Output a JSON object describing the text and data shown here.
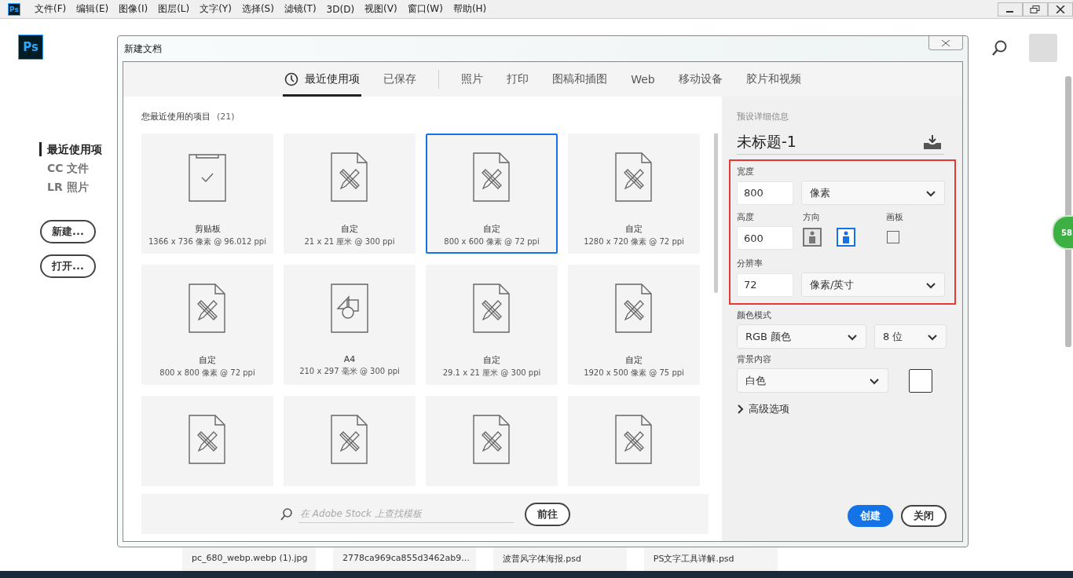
{
  "menu_bar": {
    "app_icon": "Ps",
    "items": [
      "文件(F)",
      "编辑(E)",
      "图像(I)",
      "图层(L)",
      "文字(Y)",
      "选择(S)",
      "滤镜(T)",
      "3D(D)",
      "视图(V)",
      "窗口(W)",
      "帮助(H)"
    ]
  },
  "home": {
    "logo": "Ps",
    "nav": [
      {
        "label": "最近使用项",
        "selected": true
      },
      {
        "label": "CC 文件",
        "selected": false
      },
      {
        "label": "LR 照片",
        "selected": false
      }
    ],
    "buttons": [
      "新建...",
      "打开..."
    ],
    "badge": "58"
  },
  "dialog": {
    "title": "新建文档",
    "tabs": [
      {
        "label": "最近使用项",
        "selected": true,
        "icon": true
      },
      {
        "label": "已保存",
        "selected": false
      },
      {
        "label": "照片",
        "selected": false
      },
      {
        "label": "打印",
        "selected": false
      },
      {
        "label": "图稿和插图",
        "selected": false
      },
      {
        "label": "Web",
        "selected": false
      },
      {
        "label": "移动设备",
        "selected": false
      },
      {
        "label": "胶片和视频",
        "selected": false
      }
    ],
    "recent": {
      "heading": "您最近使用的项目",
      "count": "(21)",
      "items": [
        {
          "kind": "clipboard",
          "name": "剪贴板",
          "size": "1366 x 736 像素 @ 96.012 ppi",
          "selected": false
        },
        {
          "kind": "custom",
          "name": "自定",
          "size": "21 x 21 厘米 @ 300 ppi",
          "selected": false
        },
        {
          "kind": "custom",
          "name": "自定",
          "size": "800 x 600 像素 @ 72 ppi",
          "selected": true
        },
        {
          "kind": "custom",
          "name": "自定",
          "size": "1280 x 720 像素 @ 72 ppi",
          "selected": false
        },
        {
          "kind": "custom",
          "name": "自定",
          "size": "800 x 800 像素 @ 72 ppi",
          "selected": false
        },
        {
          "kind": "shapes",
          "name": "A4",
          "size": "210 x 297 毫米 @ 300 ppi",
          "selected": false
        },
        {
          "kind": "custom",
          "name": "自定",
          "size": "29.1 x 21 厘米 @ 300 ppi",
          "selected": false
        },
        {
          "kind": "custom",
          "name": "自定",
          "size": "1920 x 500 像素 @ 75 ppi",
          "selected": false
        },
        {
          "kind": "custom",
          "selected": false
        },
        {
          "kind": "custom",
          "selected": false
        },
        {
          "kind": "custom",
          "selected": false
        },
        {
          "kind": "custom",
          "selected": false
        }
      ]
    },
    "stock_search": {
      "placeholder": "在 Adobe Stock 上查找模板",
      "button": "前往"
    },
    "details": {
      "heading": "预设详细信息",
      "doc_name": "未标题-1",
      "width": {
        "label": "宽度",
        "value": "800",
        "unit": "像素"
      },
      "height": {
        "label": "高度",
        "value": "600"
      },
      "orientation": {
        "label": "方向",
        "portrait_selected": false,
        "landscape_selected": true
      },
      "artboard": {
        "label": "画板",
        "checked": false
      },
      "resolution": {
        "label": "分辨率",
        "value": "72",
        "unit": "像素/英寸"
      },
      "color_mode": {
        "label": "颜色模式",
        "mode": "RGB 颜色",
        "depth": "8 位"
      },
      "background": {
        "label": "背景内容",
        "value": "白色"
      },
      "advanced": {
        "label": "高级选项",
        "expanded": false
      },
      "buttons": [
        {
          "label": "创建",
          "primary": true
        },
        {
          "label": "关闭",
          "primary": false
        }
      ]
    }
  },
  "recent_files": [
    "pc_680_webp.webp (1).jpg",
    "2778ca969ca855d3462ab9...",
    "波普风字体海报.psd",
    "PS文字工具详解.psd"
  ]
}
